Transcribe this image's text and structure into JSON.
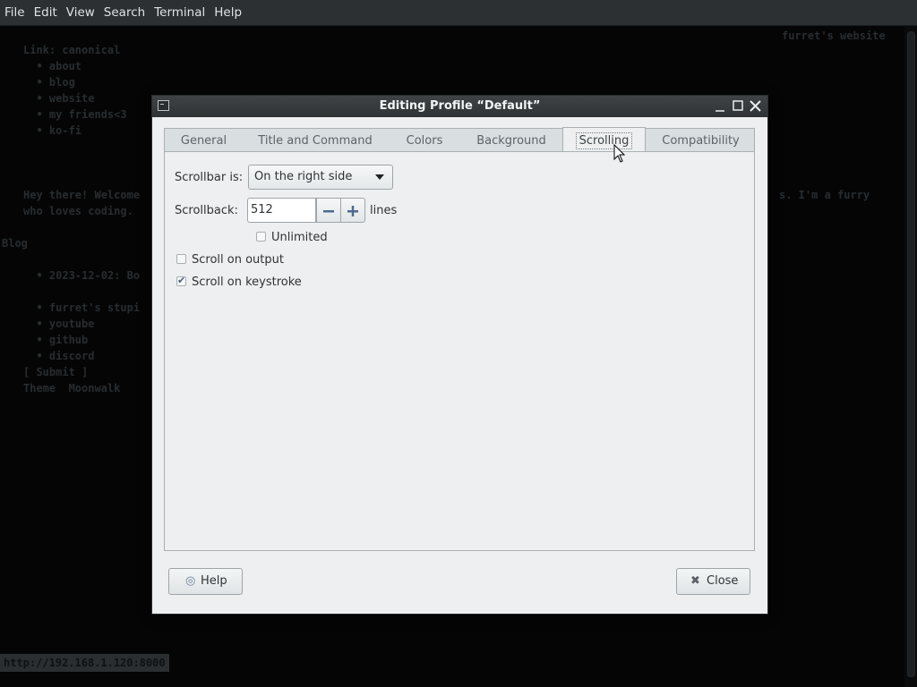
{
  "menubar": {
    "items": [
      "File",
      "Edit",
      "View",
      "Search",
      "Terminal",
      "Help"
    ]
  },
  "terminal": {
    "header_right": "furret's website",
    "lines": [
      "Link: canonical",
      "  • about",
      "  • blog",
      "  • website",
      "  • my friends<3",
      "  • ko-fi",
      "Hey there! Welcome",
      "who loves coding.",
      "Blog",
      "  • 2023-12-02: Bo",
      "  • furret's stupi",
      "  • youtube",
      "  • github",
      "  • discord",
      "[ Submit ]",
      "Theme  Moonwalk"
    ],
    "right_fragment": "s. I'm a furry",
    "highlight_word": "canonical",
    "status_url": "http://192.168.1.120:8000"
  },
  "dialog": {
    "title": "Editing Profile “Default”",
    "tabs": [
      "General",
      "Title and Command",
      "Colors",
      "Background",
      "Scrolling",
      "Compatibility"
    ],
    "active_tab": "Scrolling",
    "scrollbar_label": "Scrollbar is:",
    "scrollbar_value": "On the right side",
    "scrollback_label": "Scrollback:",
    "scrollback_value": "512",
    "scrollback_unit": "lines",
    "unlimited_label": "Unlimited",
    "unlimited_checked": false,
    "scroll_on_output_label": "Scroll on output",
    "scroll_on_output_checked": false,
    "scroll_on_keystroke_label": "Scroll on keystroke",
    "scroll_on_keystroke_checked": true,
    "help_label": "Help",
    "close_label": "Close"
  }
}
